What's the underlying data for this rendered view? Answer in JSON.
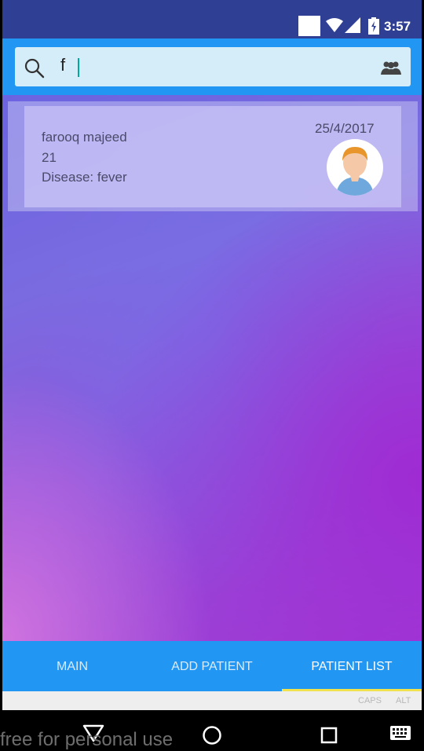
{
  "status_bar": {
    "time": "3:57"
  },
  "search": {
    "query": "f"
  },
  "patients": [
    {
      "name": "farooq majeed",
      "age": "21",
      "disease": "Disease: fever",
      "date": "25/4/2017"
    }
  ],
  "tabs": {
    "main": "MAIN",
    "add_patient": "ADD PATIENT",
    "patient_list": "PATIENT LIST",
    "selected": "PATIENT LIST"
  },
  "keyboard_strip": {
    "caps": "CAPS",
    "alt": "ALT"
  },
  "watermark": "free for personal use",
  "colors": {
    "status_bar": "#2f3f93",
    "toolbar": "#2196f3",
    "search_field": "#d5edf8",
    "tab_indicator": "#f2e24d",
    "cursor": "#00a99d"
  },
  "icons": [
    "search-icon",
    "group-icon",
    "avatar-icon",
    "wifi-icon",
    "signal-icon",
    "battery-icon",
    "back-icon",
    "home-icon",
    "recents-icon",
    "keyboard-icon"
  ]
}
